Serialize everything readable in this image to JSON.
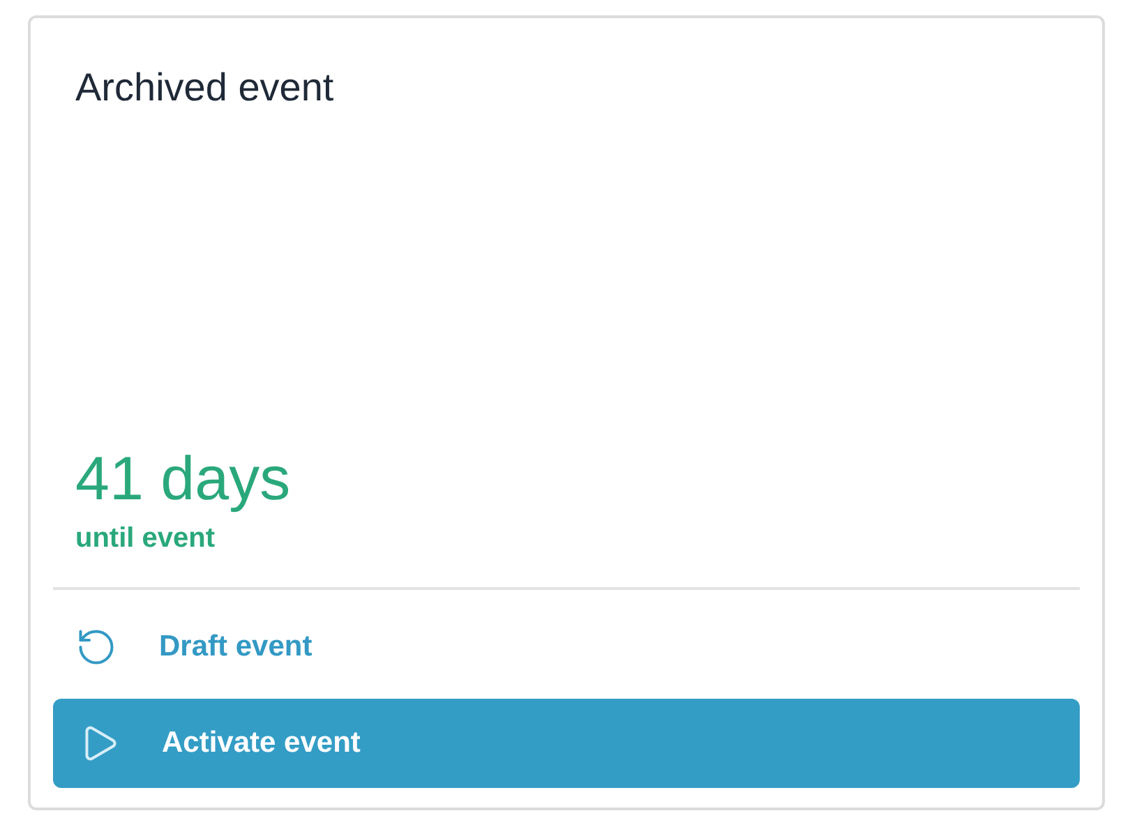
{
  "card": {
    "title": "Archived event",
    "countdown": {
      "value": "41 days",
      "caption": "until event"
    },
    "actions": [
      {
        "kind": "link",
        "label": "Draft event"
      },
      {
        "kind": "primary",
        "label": "Activate event"
      }
    ]
  }
}
